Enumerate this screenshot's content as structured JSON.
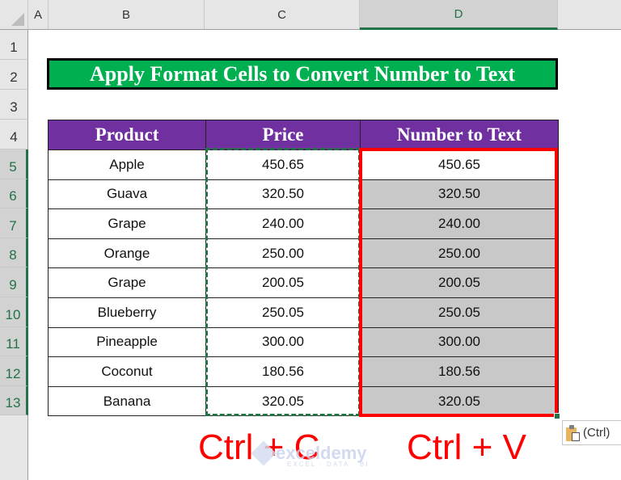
{
  "columns": [
    {
      "id": "A",
      "label": "A",
      "selected": false
    },
    {
      "id": "B",
      "label": "B",
      "selected": false
    },
    {
      "id": "C",
      "label": "C",
      "selected": false
    },
    {
      "id": "D",
      "label": "D",
      "selected": true
    }
  ],
  "rows": [
    "1",
    "2",
    "3",
    "4",
    "5",
    "6",
    "7",
    "8",
    "9",
    "10",
    "11",
    "12",
    "13"
  ],
  "selected_rows": [
    "5",
    "6",
    "7",
    "8",
    "9",
    "10",
    "11",
    "12",
    "13"
  ],
  "title": "Apply Format Cells to Convert Number to Text",
  "table": {
    "headers": [
      "Product",
      "Price",
      "Number to Text"
    ],
    "rows": [
      {
        "product": "Apple",
        "price": "450.65",
        "text": "450.65"
      },
      {
        "product": "Guava",
        "price": "320.50",
        "text": "320.50"
      },
      {
        "product": "Grape",
        "price": "240.00",
        "text": "240.00"
      },
      {
        "product": "Orange",
        "price": "250.00",
        "text": "250.00"
      },
      {
        "product": "Grape",
        "price": "200.05",
        "text": "200.05"
      },
      {
        "product": "Blueberry",
        "price": "250.05",
        "text": "250.05"
      },
      {
        "product": "Pineapple",
        "price": "300.00",
        "text": "300.00"
      },
      {
        "product": "Coconut",
        "price": "180.56",
        "text": "180.56"
      },
      {
        "product": "Banana",
        "price": "320.05",
        "text": "320.05"
      }
    ]
  },
  "hints": {
    "copy": "Ctrl + C",
    "paste": "Ctrl + V"
  },
  "paste_options": {
    "label": "(Ctrl)",
    "icon": "clipboard-icon"
  },
  "watermark": {
    "brand": "exceldemy",
    "tagline": "EXCEL · DATA · BI"
  },
  "colors": {
    "title_bg": "#00b050",
    "header_bg": "#7030a0",
    "copy_border": "#217346",
    "paste_border": "#ff0000",
    "pasted_fill": "#c8c8c8"
  }
}
